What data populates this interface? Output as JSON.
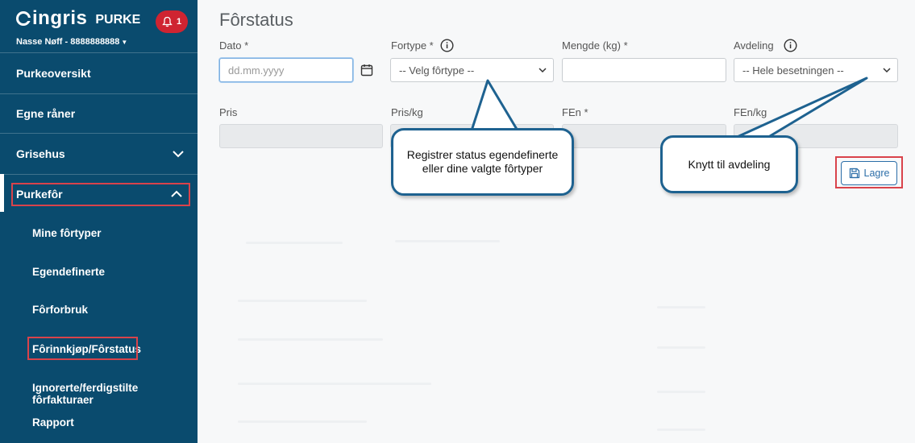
{
  "sidebar": {
    "logo": "ingris",
    "product": "PURKE",
    "notifications": "1",
    "user": "Nasse Nøff - 8888888888",
    "nav": [
      {
        "label": "Purkeoversikt"
      },
      {
        "label": "Egne råner"
      },
      {
        "label": "Grisehus"
      },
      {
        "label": "Purkefôr"
      }
    ],
    "sub": [
      {
        "label": "Mine fôrtyper"
      },
      {
        "label": "Egendefinerte"
      },
      {
        "label": "Fôrforbruk"
      },
      {
        "label": "Fôrinnkjøp/Fôrstatus"
      },
      {
        "label": "Ignorerte/ferdigstilte fôrfakturaer"
      },
      {
        "label": "Rapport"
      }
    ]
  },
  "main": {
    "title": "Fôrstatus",
    "labels": {
      "dato": "Dato *",
      "fortype": "Fortype *",
      "mengde": "Mengde (kg) *",
      "avdeling": "Avdeling",
      "pris": "Pris",
      "pris_kg": "Pris/kg",
      "fen": "FEn *",
      "fen_kg": "FEn/kg"
    },
    "dato_placeholder": "dd.mm.yyyy",
    "fortype_selected": "-- Velg fôrtype --",
    "mengde_value": "",
    "avdeling_selected": "-- Hele besetningen --",
    "save_label": "Lagre"
  },
  "callouts": {
    "fortype": "Registrer status egendefinerte eller dine valgte fôrtyper",
    "avdeling": "Knytt til avdeling"
  },
  "colors": {
    "sidebar": "#0a4b6e",
    "highlight": "#d9434b",
    "accent": "#2c6ea8",
    "badge": "#cf2431"
  }
}
